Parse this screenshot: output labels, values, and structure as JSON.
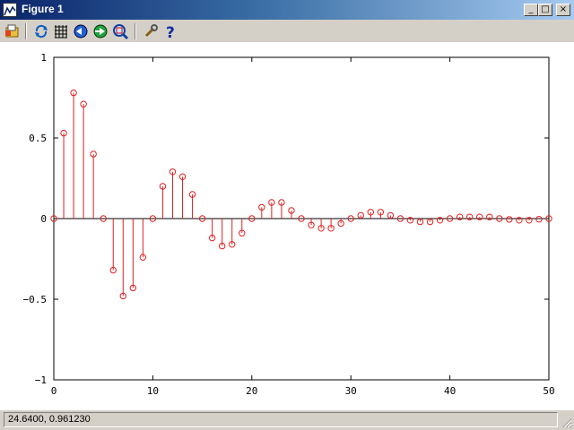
{
  "window": {
    "title": "Figure 1"
  },
  "title_buttons": {
    "minimize": "_",
    "maximize": "□",
    "close": "×"
  },
  "toolbar": [
    {
      "name": "open-icon",
      "tooltip": ""
    },
    {
      "name": "refresh-icon",
      "tooltip": ""
    },
    {
      "name": "grid-icon",
      "tooltip": ""
    },
    {
      "name": "pan-left-icon",
      "tooltip": ""
    },
    {
      "name": "pan-right-icon",
      "tooltip": ""
    },
    {
      "name": "zoom-icon",
      "tooltip": ""
    },
    {
      "name": "settings-wrench-icon",
      "tooltip": ""
    },
    {
      "name": "help-icon",
      "tooltip": "?"
    }
  ],
  "status": {
    "coords": "24.6400,  0.961230"
  },
  "colors": {
    "series": "#e02020"
  },
  "chart_data": {
    "type": "stem",
    "title": "",
    "xlabel": "",
    "ylabel": "",
    "xlim": [
      0,
      50
    ],
    "ylim": [
      -1,
      1
    ],
    "xticks": [
      0,
      10,
      20,
      30,
      40,
      50
    ],
    "yticks": [
      -1,
      -0.5,
      0,
      0.5,
      1
    ],
    "xtick_labels": [
      "0",
      "10",
      "20",
      "30",
      "40",
      "50"
    ],
    "ytick_labels": [
      "−1",
      "−0.5",
      "0",
      "0.5",
      "1"
    ],
    "grid": false,
    "series": [
      {
        "x": [
          0,
          1,
          2,
          3,
          4,
          5,
          6,
          7,
          8,
          9,
          10,
          11,
          12,
          13,
          14,
          15,
          16,
          17,
          18,
          19,
          20,
          21,
          22,
          23,
          24,
          25,
          26,
          27,
          28,
          29,
          30,
          31,
          32,
          33,
          34,
          35,
          36,
          37,
          38,
          39,
          40,
          41,
          42,
          43,
          44,
          45,
          46,
          47,
          48,
          49,
          50
        ],
        "y": [
          0,
          0.53,
          0.78,
          0.71,
          0.4,
          0,
          -0.32,
          -0.48,
          -0.43,
          -0.24,
          0,
          0.2,
          0.29,
          0.26,
          0.15,
          0,
          -0.12,
          -0.17,
          -0.16,
          -0.09,
          0,
          0.07,
          0.1,
          0.1,
          0.05,
          0,
          -0.04,
          -0.06,
          -0.06,
          -0.03,
          0,
          0.02,
          0.04,
          0.04,
          0.02,
          0,
          -0.01,
          -0.02,
          -0.02,
          -0.01,
          0,
          0.01,
          0.01,
          0.01,
          0.01,
          0,
          -0.005,
          -0.01,
          -0.01,
          -0.004,
          0
        ]
      }
    ]
  }
}
